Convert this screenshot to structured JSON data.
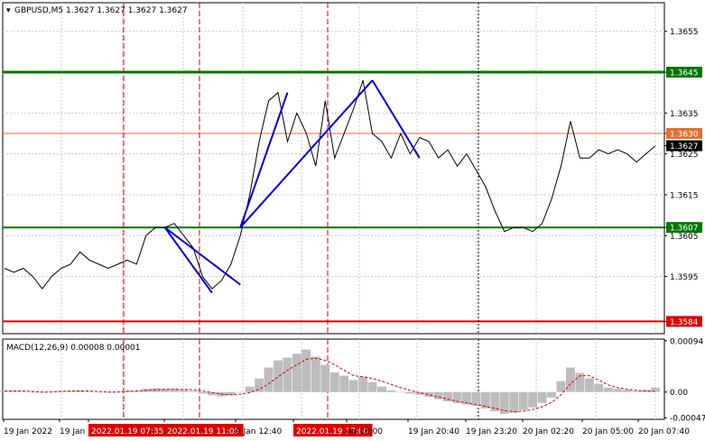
{
  "header": {
    "symbol_line": "GBPUSD,M5  1.3627 1.3627 1.3627 1.3627",
    "macd_line": "MACD(12,26,9) 0.00008 0.00001"
  },
  "colors": {
    "price": "#000000",
    "trend": "#0000cc",
    "level_green": "#007700",
    "level_orange": "#e07030",
    "level_red": "#dd0000",
    "dashed_red": "#cc0000",
    "grid": "#c8c8c8",
    "histogram": "#bdbdbd",
    "signal": "#dd0000"
  },
  "chart_data": [
    {
      "type": "line",
      "title": "GBPUSD,M5",
      "series": [
        {
          "name": "GBPUSD",
          "values": [
            1.3597,
            1.3596,
            1.3597,
            1.3595,
            1.3592,
            1.3595,
            1.3597,
            1.3598,
            1.3601,
            1.3599,
            1.3598,
            1.3597,
            1.3598,
            1.3599,
            1.3598,
            1.3605,
            1.3607,
            1.3607,
            1.3608,
            1.3605,
            1.3602,
            1.3595,
            1.3592,
            1.3594,
            1.3598,
            1.3605,
            1.3615,
            1.3628,
            1.3638,
            1.364,
            1.3628,
            1.3635,
            1.363,
            1.3622,
            1.3638,
            1.3624,
            1.363,
            1.3636,
            1.3643,
            1.363,
            1.3628,
            1.3624,
            1.363,
            1.3625,
            1.3629,
            1.3628,
            1.3624,
            1.3626,
            1.3622,
            1.3625,
            1.3621,
            1.3617,
            1.3611,
            1.3606,
            1.3607,
            1.3607,
            1.3606,
            1.3608,
            1.3614,
            1.3622,
            1.3633,
            1.3624,
            1.3624,
            1.3626,
            1.3625,
            1.3626,
            1.3625,
            1.3623,
            1.3625,
            1.3627
          ]
        }
      ],
      "x_ticks": [
        "19 Jan 2022",
        "19 Jan",
        "2022.01.19 07:35",
        "2022.01.19 11:05",
        "9 Jan 12:40",
        "2022.01.19 17:00",
        "an 18:00",
        "19 Jan 20:40",
        "19 Jan 23:20",
        "20 Jan 02:20",
        "20 Jan 05:00",
        "20 Jan 07:40"
      ],
      "y_ticks": [
        "1.3655",
        "1.3645",
        "1.3635",
        "1.3630",
        "1.3627",
        "1.3625",
        "1.3615",
        "1.3607",
        "1.3605",
        "1.3595",
        "1.3584"
      ],
      "ylim": [
        1.3581,
        1.3662
      ],
      "levels": [
        {
          "value": 1.3645,
          "label": "1.3645",
          "color": "#007700"
        },
        {
          "value": 1.363,
          "label": "1.3630",
          "color": "#e07030"
        },
        {
          "value": 1.3607,
          "label": "1.3607",
          "color": "#007700"
        },
        {
          "value": 1.3584,
          "label": "1.3584",
          "color": "#dd0000"
        }
      ],
      "current_price": "1.3627",
      "marked_times": [
        "2022.01.19 07:35",
        "2022.01.19 11:05",
        "2022.01.19 17:00"
      ],
      "trend_lines": [
        {
          "from": [
            17,
            1.3607
          ],
          "to": [
            25,
            1.3593
          ]
        },
        {
          "from": [
            17,
            1.3607
          ],
          "to": [
            22,
            1.3591
          ]
        },
        {
          "from": [
            25,
            1.3607
          ],
          "to": [
            30,
            1.364
          ]
        },
        {
          "from": [
            25,
            1.3607
          ],
          "to": [
            39,
            1.3643
          ]
        },
        {
          "from": [
            39,
            1.3643
          ],
          "to": [
            44,
            1.3624
          ]
        }
      ]
    },
    {
      "type": "bar",
      "title": "MACD(12,26,9)",
      "series": [
        {
          "name": "MACD",
          "values": [
            2e-05,
            2e-05,
            1e-05,
            0.0,
            -1e-05,
            1e-05,
            2e-05,
            2e-05,
            3e-05,
            1e-05,
            0.0,
            -1e-05,
            1e-05,
            3e-05,
            2e-05,
            6e-05,
            7e-05,
            6e-05,
            6e-05,
            4e-05,
            2e-05,
            -3e-05,
            -6e-05,
            -8e-05,
            -6e-05,
            -1e-05,
            0.0001,
            0.00025,
            0.00045,
            0.00058,
            0.00063,
            0.0007,
            0.00078,
            0.00065,
            0.0005,
            0.00036,
            0.0003,
            0.00022,
            0.00028,
            0.00018,
            0.0001,
            3e-05,
            0.0,
            -3e-05,
            -5e-05,
            -9e-05,
            -0.00013,
            -0.00017,
            -0.0002,
            -0.00023,
            -0.00025,
            -0.0003,
            -0.00035,
            -0.0004,
            -0.00038,
            -0.00033,
            -0.00028,
            -0.0002,
            -0.0001,
            0.0002,
            0.00045,
            0.00035,
            0.00025,
            0.00015,
            8e-05,
            6e-05,
            4e-05,
            2e-05,
            4e-05,
            8e-05
          ]
        },
        {
          "name": "Signal",
          "values": [
            2e-05,
            2e-05,
            2e-05,
            1e-05,
            0.0,
            0.0,
            1e-05,
            2e-05,
            2e-05,
            2e-05,
            1e-05,
            0.0,
            0.0,
            1e-05,
            2e-05,
            3e-05,
            4e-05,
            5e-05,
            5e-05,
            5e-05,
            4e-05,
            2e-05,
            -1e-05,
            -4e-05,
            -5e-05,
            -4e-05,
            -1e-05,
            5e-05,
            0.00015,
            0.00028,
            0.0004,
            0.0005,
            0.0006,
            0.00062,
            0.00058,
            0.0005,
            0.0004,
            0.0003,
            0.00028,
            0.00025,
            0.0002,
            0.00014,
            8e-05,
            3e-05,
            -1e-05,
            -5e-05,
            -9e-05,
            -0.00013,
            -0.00017,
            -0.0002,
            -0.00023,
            -0.00026,
            -0.0003,
            -0.00034,
            -0.00036,
            -0.00035,
            -0.00032,
            -0.00027,
            -0.00019,
            -5e-05,
            0.00015,
            0.0003,
            0.0003,
            0.00022,
            0.00013,
            8e-05,
            5e-05,
            3e-05,
            2e-05,
            1e-05
          ]
        }
      ],
      "y_ticks": [
        "0.00094",
        "0.00",
        "-0.00047"
      ],
      "ylim": [
        -0.0005,
        0.00097
      ]
    }
  ]
}
